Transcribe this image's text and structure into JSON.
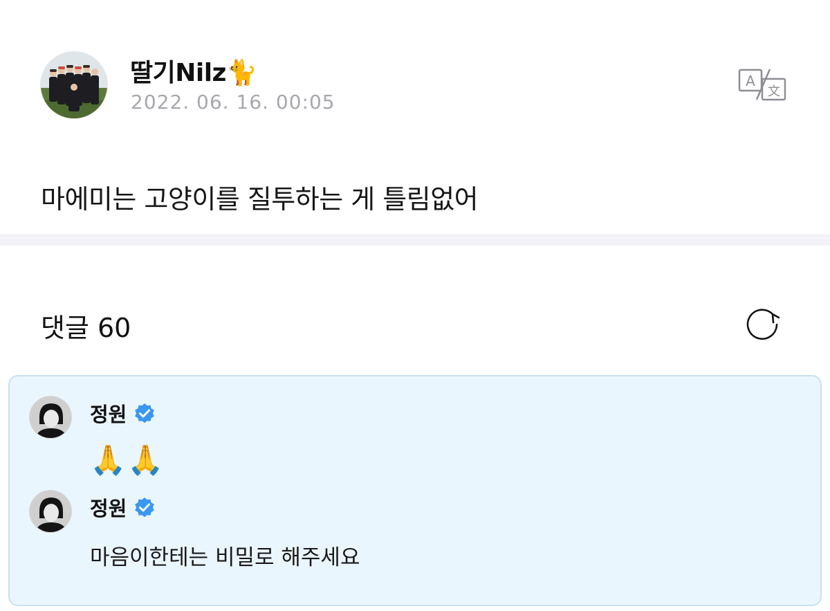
{
  "post": {
    "author": "딸기Nilz🐈",
    "timestamp": "2022. 06. 16. 00:05",
    "body": "마에미는 고양이를 질투하는 게 틀림없어"
  },
  "comments": {
    "heading": "댓글 60"
  },
  "artist_replies": [
    {
      "name": "정원",
      "text": "🙏🙏"
    },
    {
      "name": "정원",
      "text": "마음이한테는 비밀로 해주세요"
    }
  ],
  "icons": {
    "translate": "translate-icon",
    "refresh": "refresh-icon",
    "verified": "verified-badge-icon"
  },
  "colors": {
    "artist_box_bg": "#eaf6fd",
    "artist_box_border": "#c7e1ef",
    "verified_blue": "#3a97f0",
    "date_gray": "#a7a7ad",
    "divider": "#f3f3f7"
  }
}
